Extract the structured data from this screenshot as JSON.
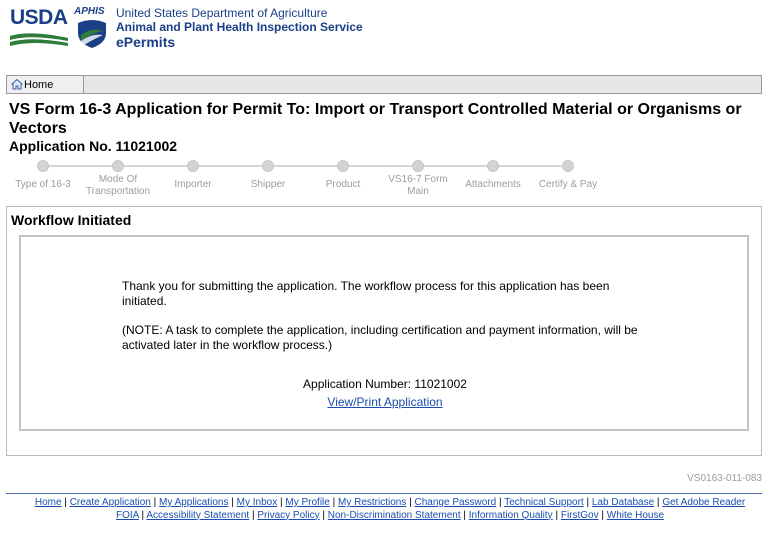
{
  "header": {
    "usda_logo_text": "USDA",
    "aphis_logo_text": "APHIS",
    "department": "United States Department of Agriculture",
    "service": "Animal and Plant Health Inspection Service",
    "app_name": "ePermits"
  },
  "nav": {
    "home_label": "Home"
  },
  "page": {
    "title": "VS Form 16-3 Application for Permit To: Import or Transport Controlled Material or Organisms or Vectors",
    "application_no_label": "Application No. 11021002"
  },
  "progress": {
    "steps": [
      {
        "label": "Type of 16-3"
      },
      {
        "label": "Mode Of Transportation"
      },
      {
        "label": "Importer"
      },
      {
        "label": "Shipper"
      },
      {
        "label": "Product"
      },
      {
        "label": "VS16-7 Form Main"
      },
      {
        "label": "Attachments"
      },
      {
        "label": "Certify & Pay"
      }
    ]
  },
  "panel": {
    "title": "Workflow Initiated",
    "message": "Thank you for submitting the application.  The workflow process for this application has been initiated.",
    "note": "(NOTE: A task to complete the application, including certification and payment information, will be activated later in the workflow process.)",
    "application_number": "Application Number: 11021002",
    "view_print_link": "View/Print Application"
  },
  "page_code": "VS0163-011-083",
  "footer": {
    "line1": [
      "Home",
      "Create Application",
      "My Applications",
      "My Inbox",
      "My Profile",
      "My Restrictions",
      "Change Password",
      "Technical Support",
      "Lab Database",
      "Get Adobe Reader"
    ],
    "line2": [
      "FOIA",
      "Accessibility Statement",
      "Privacy Policy",
      "Non-Discrimination Statement",
      "Information Quality",
      "FirstGov",
      "White House"
    ]
  },
  "colors": {
    "brand_blue": "#1b3f87",
    "usda_green": "#2e7d3a",
    "link_blue": "#1a4eb0",
    "step_gray": "#9c9c9c"
  }
}
